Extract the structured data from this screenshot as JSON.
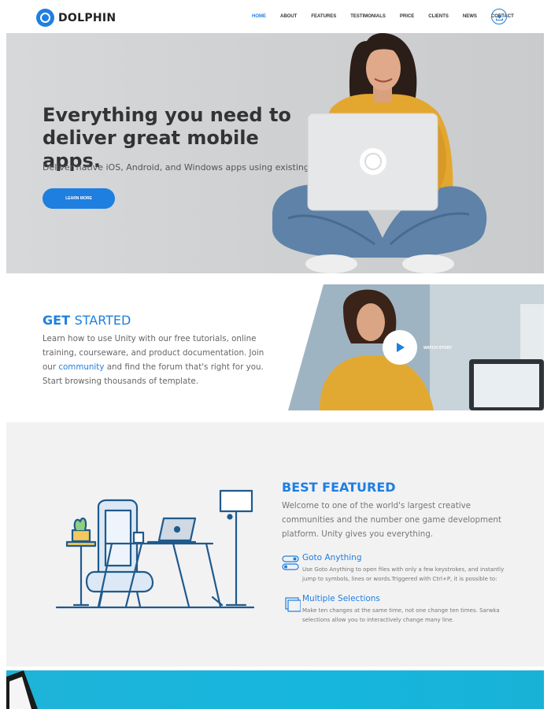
{
  "brand": {
    "name": "DOLPHIN",
    "logo_icon": "dolphin-logo-icon"
  },
  "nav": {
    "items": [
      {
        "label": "HOME",
        "active": true
      },
      {
        "label": "ABOUT",
        "active": false
      },
      {
        "label": "FEATURES",
        "active": false
      },
      {
        "label": "TESTIMONIALS",
        "active": false
      },
      {
        "label": "PRICE",
        "active": false
      },
      {
        "label": "CLIENTS",
        "active": false
      },
      {
        "label": "NEWS",
        "active": false
      },
      {
        "label": "CONTACT",
        "active": false
      }
    ],
    "download_icon": "download-icon"
  },
  "hero": {
    "title_line1": "Everything you need to",
    "title_line2": "deliver great mobile apps.",
    "subtitle": "Deliver native iOS, Android, and Windows apps using existing",
    "button_label": "LEARN MORE"
  },
  "get_started": {
    "title_bold": "GET",
    "title_rest": "STARTED",
    "text_before_link": "Learn how to use Unity with our free tutorials, online training, courseware, and product documentation. Join our ",
    "link_text": "community",
    "text_after_link": " and find the forum that's right for you. Start browsing thousands of template.",
    "video_label": "WATCH STORY",
    "play_icon": "play-icon"
  },
  "best_featured": {
    "title_bold": "BEST",
    "title_rest": "FEATURED",
    "text": "Welcome to one of the world's largest creative communities and the number one game development platform. Unity gives you everything.",
    "features": [
      {
        "title": "Goto Anything",
        "description": "Use Goto Anything to open files with only a few keystrokes, and instantly jump to symbols, lines or words.Triggered with Ctrl+P, it is possible to:",
        "icon": "toggle-icon"
      },
      {
        "title": "Multiple Selections",
        "description": "Make ten changes at the same time, not one change ten times. Sarwka selections allow you to interactively change many line.",
        "icon": "multiple-windows-icon"
      }
    ]
  },
  "colors": {
    "accent": "#1e7fe0",
    "text": "#333333",
    "muted": "#666666",
    "section_bg": "#f2f2f3",
    "band": "#17b4da"
  }
}
